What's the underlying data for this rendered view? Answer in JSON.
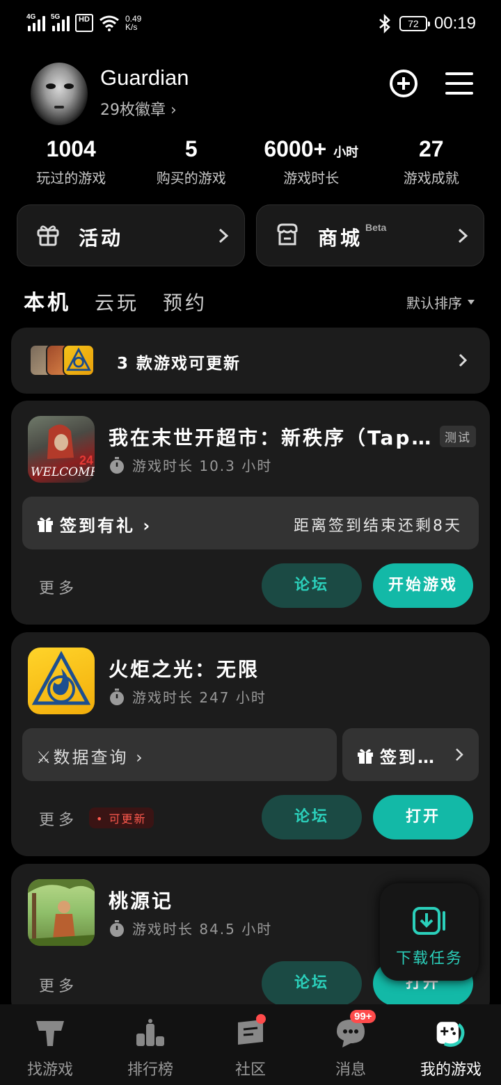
{
  "status_bar": {
    "signal1_label": "4G",
    "signal2_label": "5G",
    "hd_label": "HD",
    "net_speed_value": "0.49",
    "net_speed_unit": "K/s",
    "battery": "72",
    "time": "00:19"
  },
  "profile": {
    "username": "Guardian",
    "badges_text": "29枚徽章 ›"
  },
  "stats": [
    {
      "value": "1004",
      "unit": "",
      "label": "玩过的游戏"
    },
    {
      "value": "5",
      "unit": "",
      "label": "购买的游戏"
    },
    {
      "value": "6000+",
      "unit": "小时",
      "label": "游戏时长"
    },
    {
      "value": "27",
      "unit": "",
      "label": "游戏成就"
    }
  ],
  "quick_links": {
    "activity": "活动",
    "store": "商城",
    "store_tag": "Beta"
  },
  "tabs": {
    "local": "本机",
    "cloud": "云玩",
    "reserve": "预约",
    "sort": "默认排序"
  },
  "update_banner": {
    "text": "3 款游戏可更新"
  },
  "games": [
    {
      "title": "我在末世开超市：新秩序（Tap…",
      "tag": "测试",
      "time_text": "游戏时长 10.3 小时",
      "strip_left": "签到有礼 ›",
      "strip_right": "距离签到结束还剩8天",
      "more": "更多",
      "forum": "论坛",
      "action": "开始游戏"
    },
    {
      "title": "火炬之光：无限",
      "time_text": "游戏时长 247 小时",
      "strip_left": "⚔数据查询 ›",
      "strip_right": "签到…",
      "more": "更多",
      "update_badge": "• 可更新",
      "forum": "论坛",
      "action": "打开"
    },
    {
      "title": "桃源记",
      "time_text": "游戏时长 84.5 小时",
      "more": "更多",
      "forum": "论坛",
      "action": "打开"
    }
  ],
  "download": {
    "label": "下载任务"
  },
  "bottom_nav": [
    {
      "label": "找游戏",
      "icon": "find-games-icon"
    },
    {
      "label": "排行榜",
      "icon": "ranking-icon"
    },
    {
      "label": "社区",
      "icon": "community-icon"
    },
    {
      "label": "消息",
      "icon": "messages-icon"
    },
    {
      "label": "我的游戏",
      "icon": "my-games-icon"
    }
  ],
  "message_badge": "99+",
  "colors": {
    "accent": "#13b9a7",
    "card": "#1c1c1c",
    "forum_bg": "#1b4a44",
    "alert": "#ff4b4b"
  }
}
